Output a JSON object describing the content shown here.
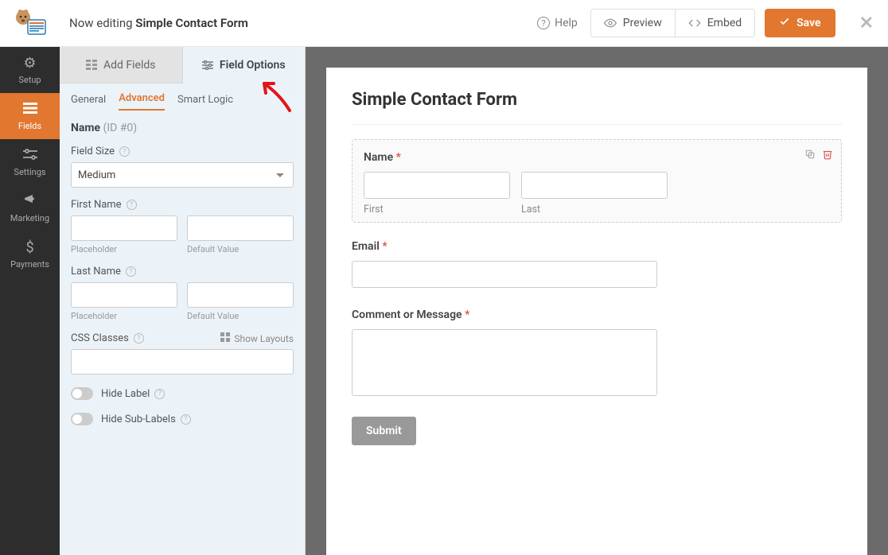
{
  "header": {
    "now_editing_prefix": "Now editing ",
    "form_name": "Simple Contact Form",
    "help": "Help",
    "preview": "Preview",
    "embed": "Embed",
    "save": "Save"
  },
  "leftnav": {
    "setup": "Setup",
    "fields": "Fields",
    "settings": "Settings",
    "marketing": "Marketing",
    "payments": "Payments"
  },
  "panel": {
    "tab_add": "Add Fields",
    "tab_options": "Field Options",
    "sub_general": "General",
    "sub_advanced": "Advanced",
    "sub_smartlogic": "Smart Logic",
    "field_name": "Name",
    "field_id": " (ID #0)",
    "lbl_field_size": "Field Size",
    "field_size_value": "Medium",
    "lbl_first_name": "First Name",
    "lbl_last_name": "Last Name",
    "lbl_placeholder": "Placeholder",
    "lbl_default": "Default Value",
    "lbl_css": "CSS Classes",
    "show_layouts": "Show Layouts",
    "hide_label": "Hide Label",
    "hide_sublabels": "Hide Sub-Labels"
  },
  "preview": {
    "title": "Simple Contact Form",
    "name_label": "Name",
    "first": "First",
    "last": "Last",
    "email_label": "Email",
    "comment_label": "Comment or Message",
    "submit": "Submit"
  }
}
